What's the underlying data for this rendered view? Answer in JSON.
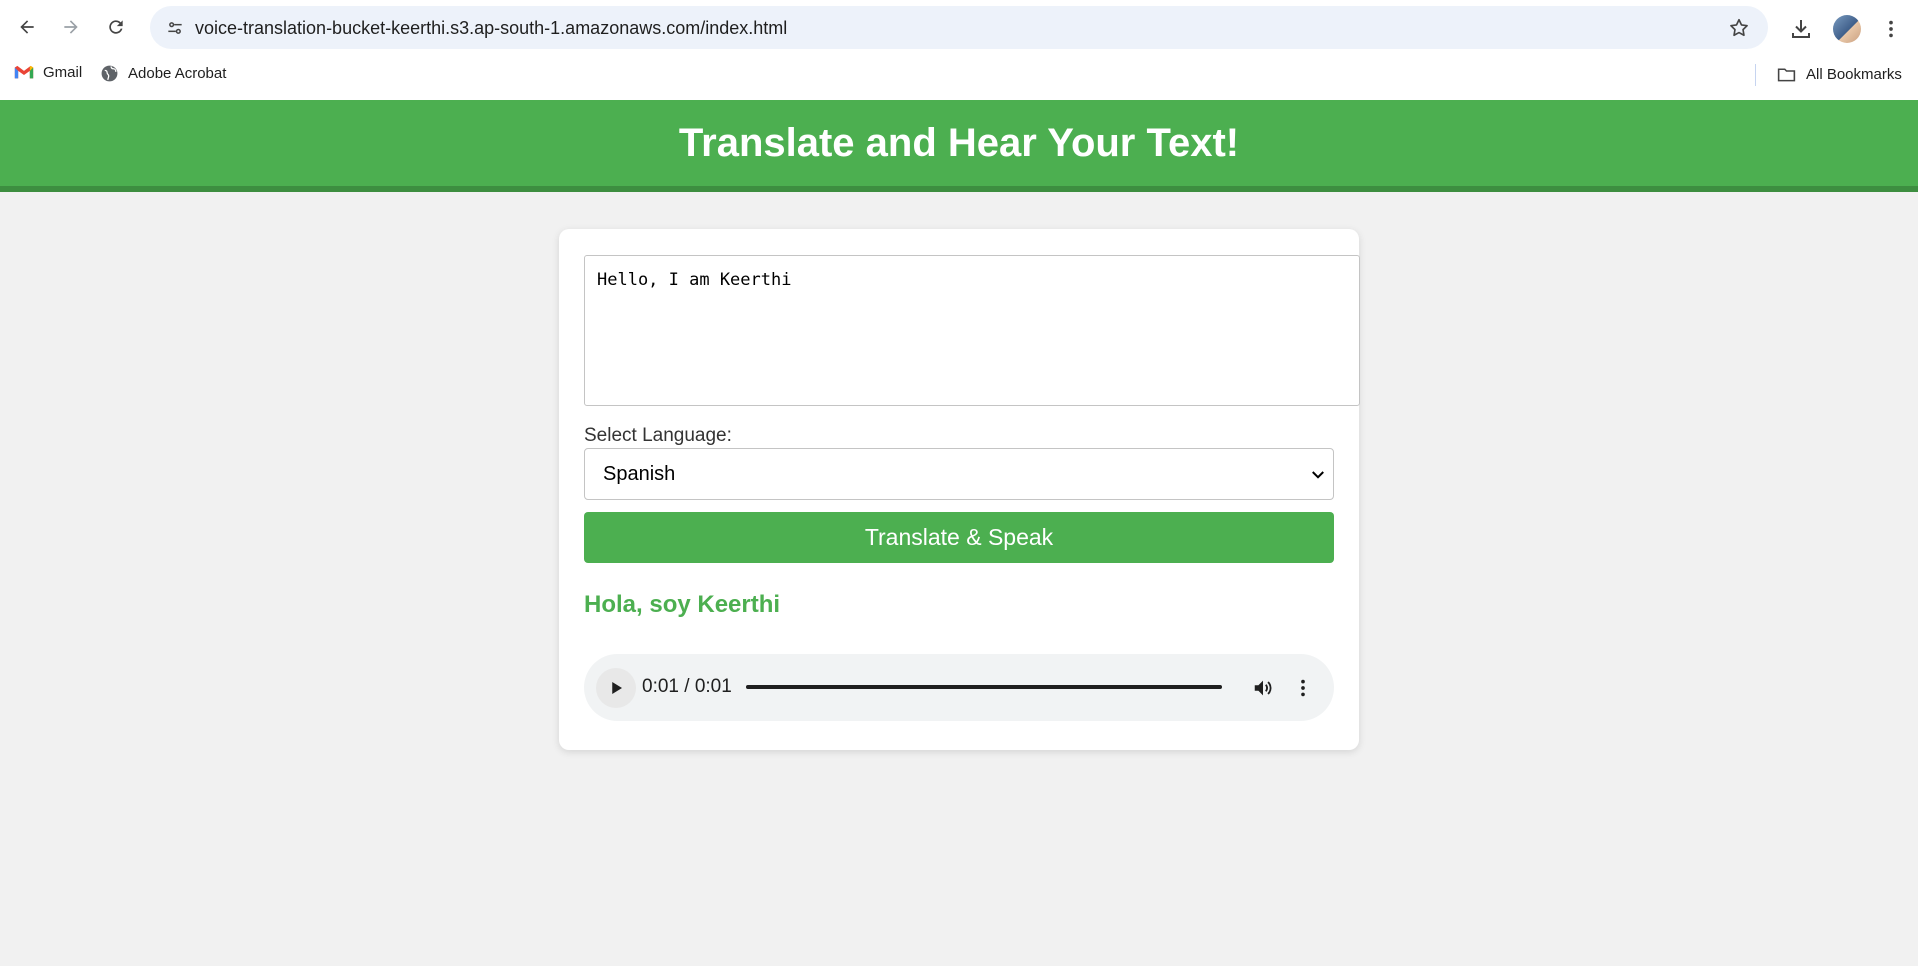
{
  "browser": {
    "url": "voice-translation-bucket-keerthi.s3.ap-south-1.amazonaws.com/index.html",
    "bookmarks": [
      {
        "label": "Gmail",
        "icon": "gmail-icon"
      },
      {
        "label": "Adobe Acrobat",
        "icon": "globe-icon"
      }
    ],
    "all_bookmarks_label": "All Bookmarks"
  },
  "page": {
    "title": "Translate and Hear Your Text!",
    "text_input_value": "Hello, I am Keerthi",
    "language_label": "Select Language:",
    "selected_language": "Spanish",
    "translate_button_label": "Translate & Speak",
    "translated_text": "Hola, soy Keerthi",
    "audio": {
      "time_display": "0:01 / 0:01",
      "progress_fraction": 1.0
    }
  },
  "colors": {
    "header_green": "#4caf50",
    "header_border": "#3d8e40",
    "page_background": "#f1f1f1"
  }
}
